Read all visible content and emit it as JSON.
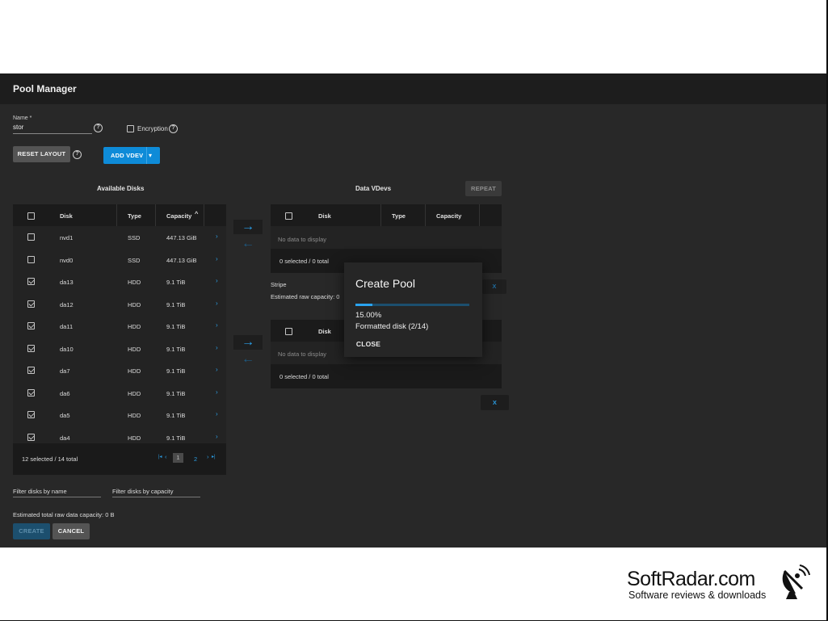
{
  "window": {
    "title": "Pool Manager"
  },
  "form": {
    "name_label": "Name *",
    "name_value": "stor",
    "encryption_label": "Encryption",
    "help_glyph": "?"
  },
  "toolbar": {
    "reset_layout": "RESET LAYOUT",
    "add_vdev": "ADD VDEV"
  },
  "available_disks": {
    "title": "Available Disks",
    "columns": [
      "Disk",
      "Type",
      "Capacity"
    ],
    "sort_indicator": "^",
    "rows": [
      {
        "disk": "nvd1",
        "type": "SSD",
        "capacity": "447.13 GiB",
        "checked": false
      },
      {
        "disk": "nvd0",
        "type": "SSD",
        "capacity": "447.13 GiB",
        "checked": false
      },
      {
        "disk": "da13",
        "type": "HDD",
        "capacity": "9.1 TiB",
        "checked": true
      },
      {
        "disk": "da12",
        "type": "HDD",
        "capacity": "9.1 TiB",
        "checked": true
      },
      {
        "disk": "da11",
        "type": "HDD",
        "capacity": "9.1 TiB",
        "checked": true
      },
      {
        "disk": "da10",
        "type": "HDD",
        "capacity": "9.1 TiB",
        "checked": true
      },
      {
        "disk": "da7",
        "type": "HDD",
        "capacity": "9.1 TiB",
        "checked": true
      },
      {
        "disk": "da6",
        "type": "HDD",
        "capacity": "9.1 TiB",
        "checked": true
      },
      {
        "disk": "da5",
        "type": "HDD",
        "capacity": "9.1 TiB",
        "checked": true
      },
      {
        "disk": "da4",
        "type": "HDD",
        "capacity": "9.1 TiB",
        "checked": true
      }
    ],
    "row_chevron": "›",
    "footer": "12 selected / 14 total",
    "pager": {
      "first": "|◂",
      "prev": "‹",
      "page1": "1",
      "page2": "2",
      "next": "›",
      "last": "▸|"
    }
  },
  "data_vdevs": {
    "title": "Data VDevs",
    "repeat": "REPEAT",
    "columns": [
      "Disk",
      "Type",
      "Capacity"
    ],
    "empty": "No data to display",
    "footer": "0 selected / 0 total",
    "layout": "Stripe",
    "est_raw": "Estimated raw capacity: 0",
    "remove": "X"
  },
  "vdev2": {
    "columns": [
      "Disk"
    ],
    "empty": "No data to display",
    "footer": "0 selected / 0 total",
    "remove": "X"
  },
  "filters": {
    "by_name": "Filter disks by name",
    "by_capacity": "Filter disks by capacity"
  },
  "summary": {
    "est_total": "Estimated total raw data capacity: 0 B"
  },
  "actions": {
    "create": "CREATE",
    "cancel": "CANCEL"
  },
  "modal": {
    "title": "Create Pool",
    "progress_fraction": 0.15,
    "percent": "15.00%",
    "status": "Formatted disk (2/14)",
    "close": "CLOSE"
  },
  "icons": {
    "arrow_right": "→",
    "arrow_left": "←",
    "caret_down": "▾"
  },
  "watermark": {
    "name": "SoftRadar.com",
    "tagline": "Software reviews & downloads"
  },
  "colors": {
    "accent": "#0e8bd8",
    "background": "#282828",
    "header": "#1d1d1d"
  }
}
